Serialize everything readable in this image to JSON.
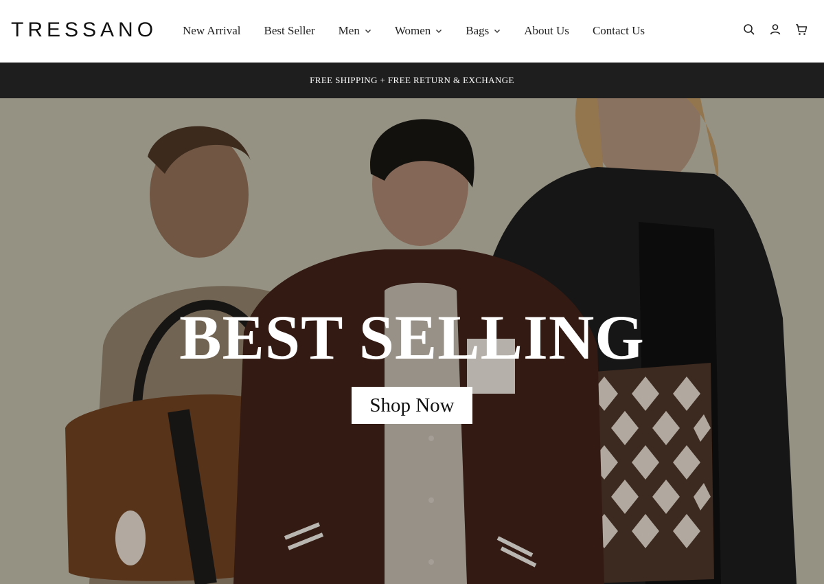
{
  "header": {
    "logo": "TRESSANO",
    "nav": [
      {
        "label": "New Arrival",
        "dropdown": false
      },
      {
        "label": "Best Seller",
        "dropdown": false
      },
      {
        "label": "Men",
        "dropdown": true
      },
      {
        "label": "Women",
        "dropdown": true
      },
      {
        "label": "Bags",
        "dropdown": true
      },
      {
        "label": "About Us",
        "dropdown": false
      },
      {
        "label": "Contact Us",
        "dropdown": false
      }
    ],
    "icons": [
      "search-icon",
      "account-icon",
      "cart-icon"
    ]
  },
  "announcement": "FREE SHIPPING + FREE RETURN & EXCHANGE",
  "hero": {
    "title": "BEST SELLING",
    "button": "Shop Now",
    "bg_color": "#b6b3a2"
  }
}
